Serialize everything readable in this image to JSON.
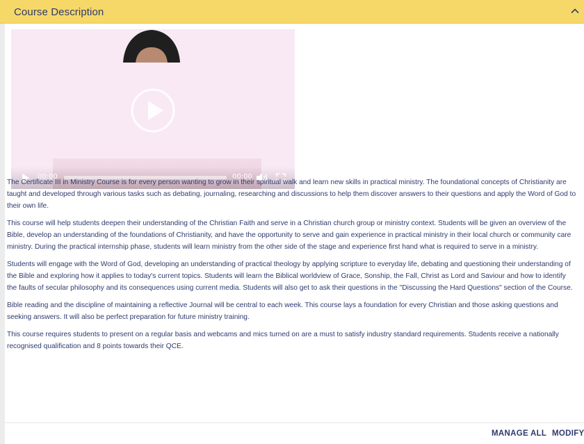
{
  "accordion": {
    "title": "Course Description",
    "collapse_icon": "chevron-up-icon"
  },
  "video": {
    "current_time": "00:00",
    "duration": "00:00",
    "progress": 0,
    "icons": {
      "big_play": "play-circle-icon",
      "play": "play-icon",
      "volume": "volume-icon",
      "fullscreen": "fullscreen-icon"
    }
  },
  "description": {
    "paragraphs": [
      "The Certificate III  in Ministry Course is for every person wanting to grow in their spiritual walk and learn new skills in practical ministry. The foundational concepts of Christianity are taught and developed through various tasks such as debating, journaling, researching and discussions to help them discover answers to their questions and apply the Word of God to their own life.",
      "This course will help students deepen their understanding of the Christian Faith and serve in a Christian church group or ministry context. Students will be given an overview of the Bible, develop an understanding of the foundations of Christianity, and have the opportunity to serve and gain experience in practical ministry in their local church or community care ministry. During the practical internship phase, students will learn ministry from the other side of the stage and experience first hand what is required to serve in a ministry.",
      "Students will engage with the Word of God, developing an understanding of practical theology by applying scripture to everyday life,  debating and questioning their understanding of the Bible and exploring how it applies to today's current topics. Students will learn the Biblical worldview of Grace, Sonship, the Fall, Christ as Lord and Saviour and how to identify the faults of secular philosophy and its consequences using current media. Students will also get to ask their questions in the \"Discussing the Hard Questions\" section of the Course.",
      "Bible reading and the discipline of maintaining a reflective Journal will be central to each week. This course lays a foundation for every Christian and those asking questions and seeking answers.  It will also be perfect preparation for future ministry training.",
      "This course requires students to present on a regular basis and webcams and mics turned on are a must to satisfy industry standard requirements. Students receive a nationally recognised qualification and 8 points towards their QCE."
    ]
  },
  "footer": {
    "manage_all": "MANAGE ALL",
    "modify": "MODIFY"
  },
  "colors": {
    "header_bg": "#f6d868",
    "text": "#2f3a6e",
    "video_bg": "#f9e9f5"
  }
}
